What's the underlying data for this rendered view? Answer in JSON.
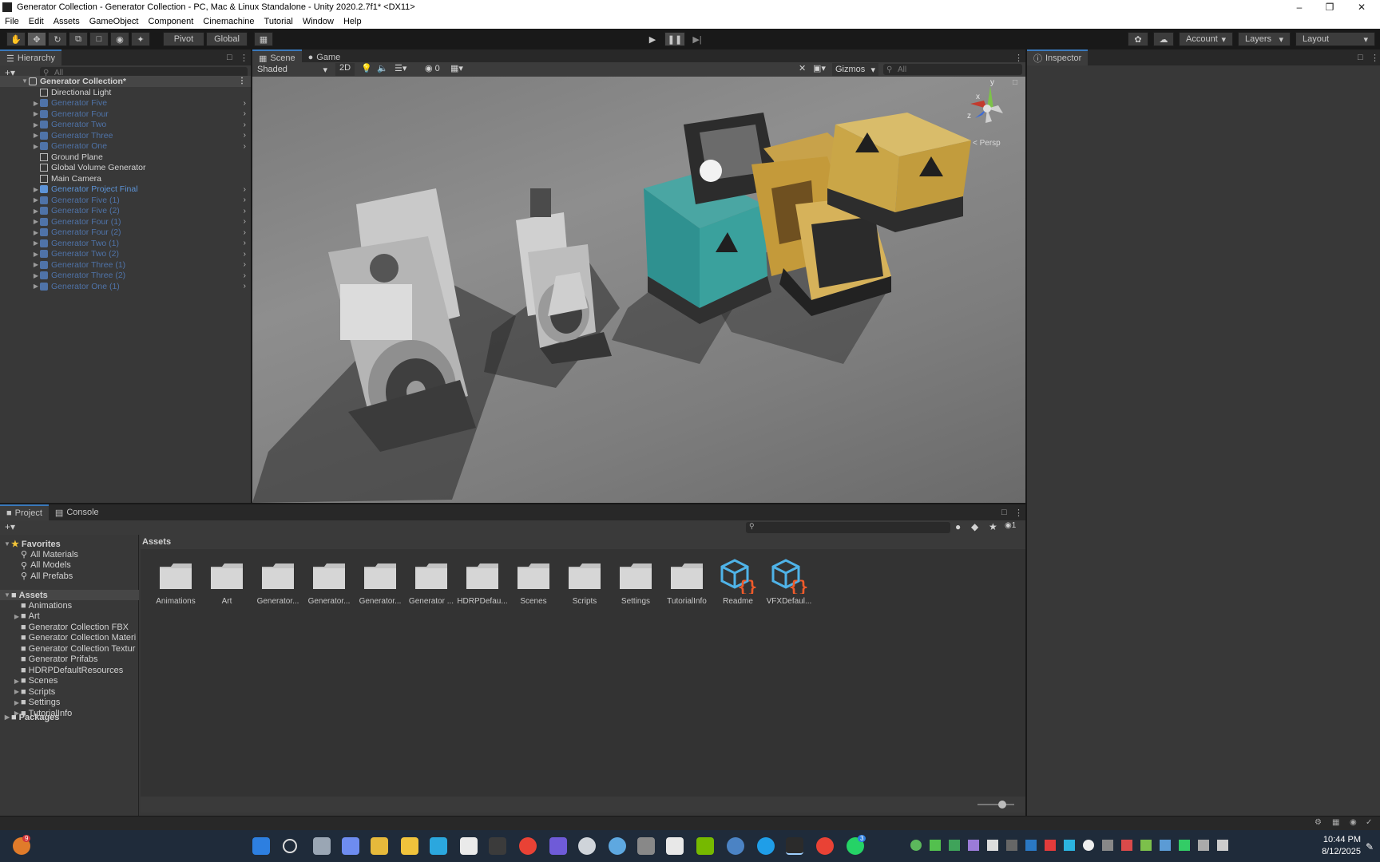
{
  "window": {
    "title": "Generator Collection - Generator Collection - PC, Mac & Linux Standalone - Unity 2020.2.7f1* <DX11>"
  },
  "menu": [
    "File",
    "Edit",
    "Assets",
    "GameObject",
    "Component",
    "Cinemachine",
    "Tutorial",
    "Window",
    "Help"
  ],
  "toolbar": {
    "pivot_label": "Pivot",
    "global_label": "Global",
    "account_label": "Account",
    "layers_label": "Layers",
    "layout_label": "Layout"
  },
  "hierarchy": {
    "title": "Hierarchy",
    "search_placeholder": "All",
    "scene_name": "Generator Collection*",
    "items": [
      {
        "label": "Directional Light",
        "type": "object"
      },
      {
        "label": "Generator Five",
        "type": "prefab-dim"
      },
      {
        "label": "Generator Four",
        "type": "prefab-dim"
      },
      {
        "label": "Generator Two",
        "type": "prefab-dim"
      },
      {
        "label": "Generator Three",
        "type": "prefab-dim"
      },
      {
        "label": "Generator One",
        "type": "prefab-dim"
      },
      {
        "label": "Ground Plane",
        "type": "object"
      },
      {
        "label": "Global Volume Generator",
        "type": "object"
      },
      {
        "label": "Main Camera",
        "type": "object"
      },
      {
        "label": "Generator Project Final",
        "type": "prefab"
      },
      {
        "label": "Generator Five (1)",
        "type": "prefab-dim"
      },
      {
        "label": "Generator Five (2)",
        "type": "prefab-dim"
      },
      {
        "label": "Generator Four (1)",
        "type": "prefab-dim"
      },
      {
        "label": "Generator Four (2)",
        "type": "prefab-dim"
      },
      {
        "label": "Generator Two (1)",
        "type": "prefab-dim"
      },
      {
        "label": "Generator Two (2)",
        "type": "prefab-dim"
      },
      {
        "label": "Generator Three (1)",
        "type": "prefab-dim"
      },
      {
        "label": "Generator Three (2)",
        "type": "prefab-dim"
      },
      {
        "label": "Generator One (1)",
        "type": "prefab-dim"
      }
    ]
  },
  "scene_view": {
    "tabs": [
      "Scene",
      "Game"
    ],
    "shading": "Shaded",
    "mode_2d": "2D",
    "hidden_count": "0",
    "gizmos_label": "Gizmos",
    "search_placeholder": "All",
    "persp_label": "< Persp",
    "axis_y": "y",
    "axis_x": "x",
    "axis_z": "z"
  },
  "inspector": {
    "title": "Inspector"
  },
  "project": {
    "tabs": [
      "Project",
      "Console"
    ],
    "favorites_label": "Favorites",
    "favorites": [
      "All Materials",
      "All Models",
      "All Prefabs"
    ],
    "assets_root": "Assets",
    "assets_tree": [
      "Animations",
      "Art",
      "Generator Collection FBX",
      "Generator Collection Materi",
      "Generator Collection Textur",
      "Generator Prifabs",
      "HDRPDefaultResources",
      "Scenes",
      "Scripts",
      "Settings",
      "TutorialInfo"
    ],
    "packages_label": "Packages",
    "breadcrumb": "Assets",
    "hidden_count": "1",
    "grid": [
      {
        "label": "Animations",
        "kind": "folder"
      },
      {
        "label": "Art",
        "kind": "folder"
      },
      {
        "label": "Generator...",
        "kind": "folder"
      },
      {
        "label": "Generator...",
        "kind": "folder"
      },
      {
        "label": "Generator...",
        "kind": "folder"
      },
      {
        "label": "Generator ...",
        "kind": "folder"
      },
      {
        "label": "HDRPDefau...",
        "kind": "folder"
      },
      {
        "label": "Scenes",
        "kind": "folder"
      },
      {
        "label": "Scripts",
        "kind": "folder"
      },
      {
        "label": "Settings",
        "kind": "folder"
      },
      {
        "label": "TutorialInfo",
        "kind": "folder"
      },
      {
        "label": "Readme",
        "kind": "script"
      },
      {
        "label": "VFXDefaul...",
        "kind": "script"
      }
    ]
  },
  "taskbar": {
    "time": "10:44 PM",
    "date": "8/12/2025",
    "weather_badge": "9",
    "chrome_badge": "",
    "whatsapp_badge": "3"
  },
  "colors": {
    "accent": "#3a79bb",
    "prefab": "#5d93d6",
    "panel": "#383838",
    "toolbar": "#191919"
  }
}
